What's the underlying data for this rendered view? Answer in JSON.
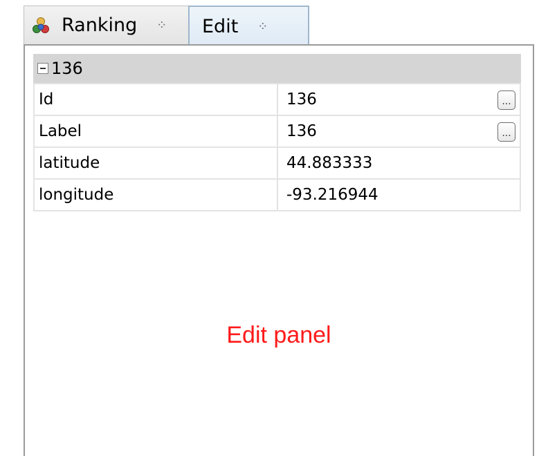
{
  "tabs": [
    {
      "label": "Ranking",
      "icon": "ranking-icon",
      "close": "⁘"
    },
    {
      "label": "Edit",
      "close": "⁘"
    }
  ],
  "group": {
    "title": "136"
  },
  "properties": [
    {
      "name": "Id",
      "value": "136",
      "has_button": true
    },
    {
      "name": "Label",
      "value": "136",
      "has_button": true
    },
    {
      "name": "latitude",
      "value": "44.883333",
      "has_button": false
    },
    {
      "name": "longitude",
      "value": "-93.216944",
      "has_button": false
    }
  ],
  "button_label": "...",
  "caption": "Edit panel",
  "colors": {
    "caption": "#ff1a1a",
    "header_bg": "#d5d5d5"
  }
}
